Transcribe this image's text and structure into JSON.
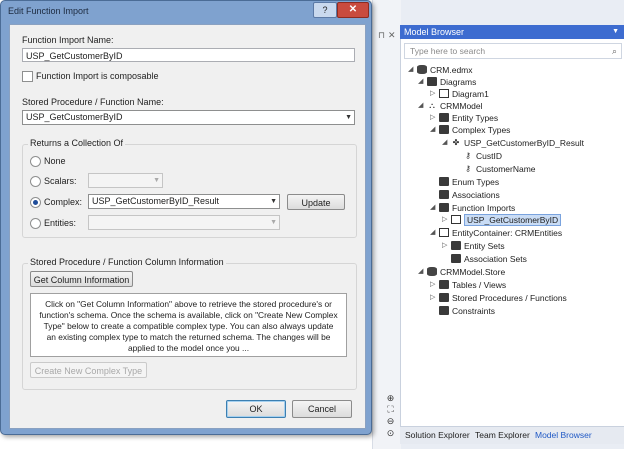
{
  "dialog": {
    "title": "Edit Function Import",
    "help": "?",
    "close": "✕",
    "function_import_name_label": "Function Import Name:",
    "function_import_name_value": "USP_GetCustomerByID",
    "composable_label": "Function Import is composable",
    "stored_procedure_label": "Stored Procedure / Function Name:",
    "stored_procedure_value": "USP_GetCustomerByID",
    "returns_label": "Returns a Collection Of",
    "returns_options": {
      "none": "None",
      "scalars": "Scalars:",
      "complex": "Complex:",
      "entities": "Entities:"
    },
    "complex_value": "USP_GetCustomerByID_Result",
    "update_button": "Update",
    "column_info_label": "Stored Procedure / Function Column Information",
    "get_column_info_button": "Get Column Information",
    "info_text": "Click on \"Get Column Information\" above to retrieve the stored procedure's or function's schema. Once the schema is available, click on \"Create New Complex Type\" below to create a compatible complex type. You can also always update an existing complex type to match the returned schema. The changes will be applied to the model once you ...",
    "create_complex_button": "Create New Complex Type",
    "ok_button": "OK",
    "cancel_button": "Cancel"
  },
  "model_browser": {
    "title": "Model Browser",
    "search_placeholder": "Type here to search",
    "tree": {
      "crm_edmx": "CRM.edmx",
      "diagrams": "Diagrams",
      "diagram1": "Diagram1",
      "crm_model": "CRMModel",
      "entity_types": "Entity Types",
      "complex_types": "Complex Types",
      "complex_result": "USP_GetCustomerByID_Result",
      "cust_id": "CustID",
      "customer_name": "CustomerName",
      "enum_types": "Enum Types",
      "associations": "Associations",
      "function_imports": "Function Imports",
      "function_import_item": "USP_GetCustomerByID",
      "entity_container": "EntityContainer: CRMEntities",
      "entity_sets": "Entity Sets",
      "association_sets": "Association Sets",
      "crm_model_store": "CRMModel.Store",
      "tables_views": "Tables / Views",
      "stored_procedures": "Stored Procedures / Functions",
      "constraints": "Constraints"
    },
    "tabs": [
      "Solution Explorer",
      "Team Explorer",
      "Model Browser"
    ]
  },
  "colors": {
    "accent": "#3d6cd0",
    "dialog_frame": "#7fa2cf",
    "selected": "#c9dcf5"
  }
}
